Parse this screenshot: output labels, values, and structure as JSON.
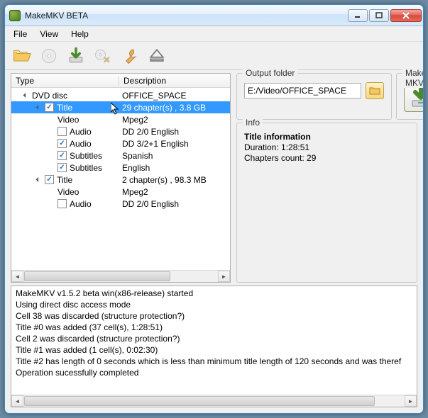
{
  "window": {
    "title": "MakeMKV BETA"
  },
  "menu": {
    "file": "File",
    "view": "View",
    "help": "Help"
  },
  "tree": {
    "header_type": "Type",
    "header_desc": "Description",
    "rows": [
      {
        "indent": 0,
        "expander": "open",
        "checkbox": null,
        "type": "DVD disc",
        "desc": "OFFICE_SPACE",
        "selected": false
      },
      {
        "indent": 1,
        "expander": "open",
        "checkbox": true,
        "type": "Title",
        "desc": "29 chapter(s) , 3.8 GB",
        "selected": true
      },
      {
        "indent": 2,
        "expander": null,
        "checkbox": null,
        "type": "Video",
        "desc": "Mpeg2",
        "selected": false
      },
      {
        "indent": 2,
        "expander": null,
        "checkbox": false,
        "type": "Audio",
        "desc": "DD 2/0 English",
        "selected": false
      },
      {
        "indent": 2,
        "expander": null,
        "checkbox": true,
        "type": "Audio",
        "desc": "DD 3/2+1 English",
        "selected": false
      },
      {
        "indent": 2,
        "expander": null,
        "checkbox": true,
        "type": "Subtitles",
        "desc": "Spanish",
        "selected": false
      },
      {
        "indent": 2,
        "expander": null,
        "checkbox": true,
        "type": "Subtitles",
        "desc": "English",
        "selected": false
      },
      {
        "indent": 1,
        "expander": "open",
        "checkbox": true,
        "type": "Title",
        "desc": "2 chapter(s) , 98.3 MB",
        "selected": false
      },
      {
        "indent": 2,
        "expander": null,
        "checkbox": null,
        "type": "Video",
        "desc": "Mpeg2",
        "selected": false
      },
      {
        "indent": 2,
        "expander": null,
        "checkbox": false,
        "type": "Audio",
        "desc": "DD 2/0 English",
        "selected": false
      }
    ]
  },
  "output": {
    "label": "Output folder",
    "value": "E:/Video/OFFICE_SPACE"
  },
  "make": {
    "label": "Make MKV"
  },
  "info": {
    "label": "Info",
    "title": "Title information",
    "lines": [
      "Duration: 1:28:51",
      "Chapters count: 29"
    ]
  },
  "log": {
    "lines": [
      "MakeMKV v1.5.2 beta win(x86-release) started",
      "Using direct disc access mode",
      "Cell 38 was discarded (structure protection?)",
      "Title #0 was added (37 cell(s), 1:28:51)",
      "Cell 2 was discarded (structure protection?)",
      "Title #1 was added (1 cell(s), 0:02:30)",
      "Title #2 has length of 0 seconds which is less than minimum title length of 120 seconds and was theref",
      "Operation sucessfully completed"
    ]
  }
}
